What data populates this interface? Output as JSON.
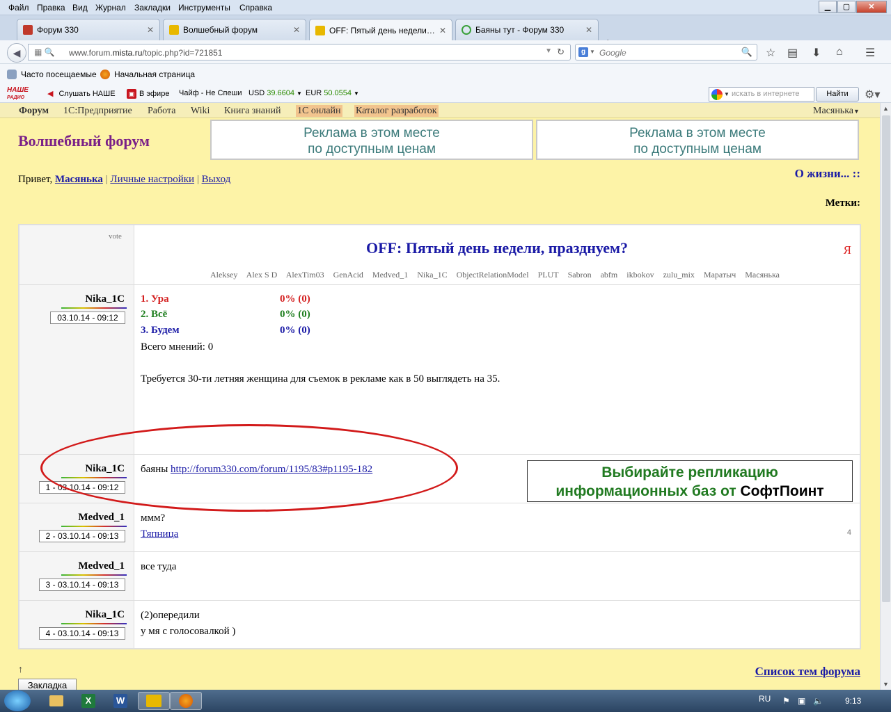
{
  "menubar": {
    "items": [
      "Файл",
      "Правка",
      "Вид",
      "Журнал",
      "Закладки",
      "Инструменты",
      "Справка"
    ]
  },
  "window_controls": {
    "minimize": "▁",
    "maximize": "▢",
    "close": "✕"
  },
  "tabs": [
    {
      "label": "Форум 330",
      "icon": "fox-icon",
      "color": "#c0392b"
    },
    {
      "label": "Волшебный форум",
      "icon": "1c-icon",
      "color": "#e8b800"
    },
    {
      "label": "OFF: Пятый день недели, ...",
      "icon": "1c-icon",
      "color": "#e8b800"
    },
    {
      "label": "Баяны тут - Форум 330",
      "icon": "loading-icon",
      "color": "#3aa03a"
    }
  ],
  "new_tab": "+",
  "address": {
    "prefix": "www.forum.",
    "domain": "mista.ru",
    "path": "/topic.php?id=721851"
  },
  "search": {
    "placeholder": "Google",
    "engine_letter": "g"
  },
  "bookmarks": [
    {
      "label": "Часто посещаемые",
      "icon": "star-folder-icon"
    },
    {
      "label": "Начальная страница",
      "icon": "firefox-icon"
    }
  ],
  "radiobar": {
    "logo_top": "НАШЕ",
    "logo_bottom": "РАДИО",
    "listen": "Слушать НАШЕ",
    "on_air": "В эфире",
    "track": "Чайф - Не Спеши",
    "usd_label": "USD",
    "usd_value": "39.6604",
    "eur_label": "EUR",
    "eur_value": "50.0554",
    "web_search_placeholder": "искать в интернете",
    "find_button": "Найти"
  },
  "forum_nav": {
    "items": [
      "Форум",
      "1С:Предприятие",
      "Работа",
      "Wiki",
      "Книга знаний",
      "1С онлайн",
      "Каталог разработок"
    ],
    "user_menu": "Масянька"
  },
  "site_title": "Волшебный форум",
  "ads": {
    "line1": "Реклама в этом месте",
    "line2": "по доступным ценам"
  },
  "greeting": {
    "prefix": "Привет,",
    "user": "Масянька",
    "settings": "Личные настройки",
    "logout": "Выход",
    "sep": "|"
  },
  "section_link": "О жизни... ::",
  "tags_label": "Метки:",
  "topic": {
    "vote_label": "vote",
    "title": "OFF: Пятый день недели, празднуем?",
    "ya": "Я",
    "participants": [
      "Aleksey",
      "Alex S D",
      "AlexTim03",
      "GenAcid",
      "Medved_1",
      "Nika_1C",
      "ObjectRelationModel",
      "PLUT",
      "Sabron",
      "abfm",
      "ikbokov",
      "zulu_mix",
      "Маратыч",
      "Масянька"
    ]
  },
  "first_post": {
    "author": "Nika_1C",
    "date": "03.10.14 - 09:12",
    "poll": [
      {
        "label": "1. Ура",
        "result": "0% (0)",
        "color": "#d42020"
      },
      {
        "label": "2. Всё",
        "result": "0% (0)",
        "color": "#1e7e1e"
      },
      {
        "label": "3. Будем",
        "result": "0% (0)",
        "color": "#1a1aa6"
      }
    ],
    "total": "Всего мнений: 0",
    "text": "Требуется 30-ти летняя женщина для съемок в рекламе как в 50 выглядеть на 35.",
    "ad_line1": "Выбирайте репликацию",
    "ad_line2_green": "информационных баз от",
    "ad_line2_black": "СофтПоинт"
  },
  "replies": [
    {
      "author": "Nika_1C",
      "date": "1 - 03.10.14 - 09:12",
      "line1_prefix": "баяны",
      "link": "http://forum330.com/forum/1195/83#p1195-182",
      "line2": "",
      "num": ""
    },
    {
      "author": "Medved_1",
      "date": "2 - 03.10.14 - 09:13",
      "line1_prefix": "ммм?",
      "link": "",
      "line2": "Тяпница",
      "num": "4"
    },
    {
      "author": "Medved_1",
      "date": "3 - 03.10.14 - 09:13",
      "line1_prefix": "все туда",
      "link": "",
      "line2": "",
      "num": ""
    },
    {
      "author": "Nika_1C",
      "date": "4 - 03.10.14 - 09:13",
      "line1_prefix": "(2)опередили",
      "link": "",
      "line2": "у мя с голосовалкой )",
      "num": ""
    }
  ],
  "footer": {
    "up_arrow": "↑",
    "bookmark_button": "Закладка",
    "list_link": "Список тем форума"
  },
  "taskbar": {
    "lang": "RU",
    "time": "9:13"
  }
}
